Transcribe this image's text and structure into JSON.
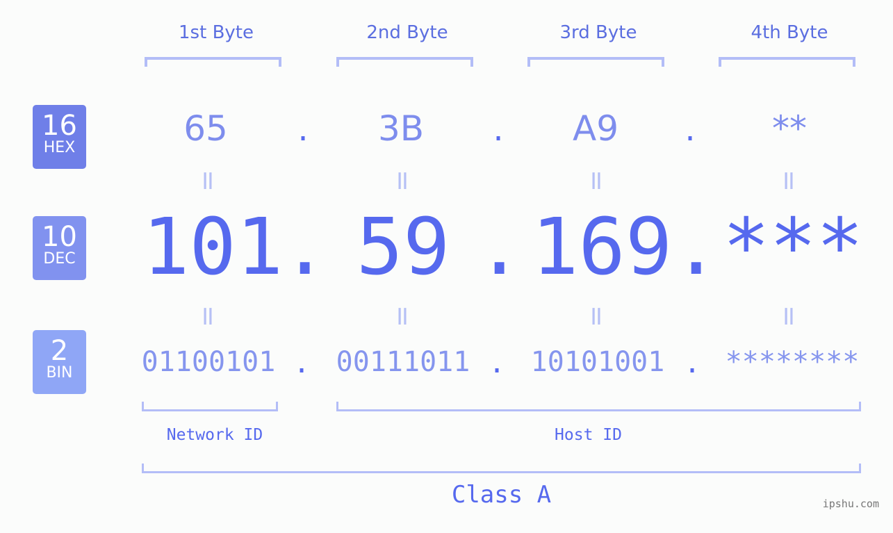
{
  "badges": [
    {
      "base": "16",
      "label": "HEX",
      "color": "#6f7fe8"
    },
    {
      "base": "10",
      "label": "DEC",
      "color": "#8192ef"
    },
    {
      "base": "2",
      "label": "BIN",
      "color": "#8fa6f6"
    }
  ],
  "byte_headers": [
    "1st Byte",
    "2nd Byte",
    "3rd Byte",
    "4th Byte"
  ],
  "hex": [
    "65",
    "3B",
    "A9",
    "**"
  ],
  "dec": [
    "101",
    "59",
    "169",
    "***"
  ],
  "bin": [
    "01100101",
    "00111011",
    "10101001",
    "********"
  ],
  "separator": ".",
  "equals": "=",
  "network_id_label": "Network ID",
  "host_id_label": "Host ID",
  "class_label": "Class A",
  "watermark": "ipshu.com",
  "colors": {
    "accent": "#5669ee",
    "bracket": "#b3bdf7",
    "background": "#fbfcfb"
  }
}
